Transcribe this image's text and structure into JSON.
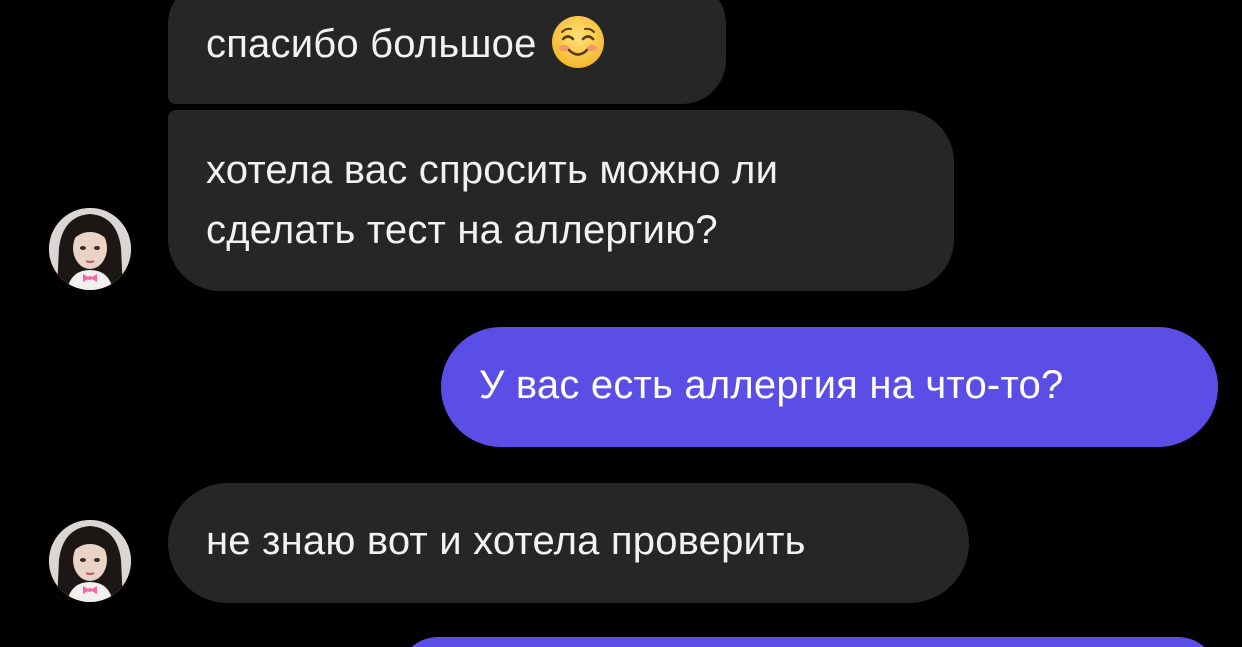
{
  "chat": {
    "messages": [
      {
        "sender": "contact",
        "text": "спасибо большое",
        "emoji": "smiling-face-emoji"
      },
      {
        "sender": "contact",
        "lines": [
          "хотела вас спросить можно ли",
          "сделать тест на аллергию?"
        ]
      },
      {
        "sender": "me",
        "text": "У вас есть аллергия на что-то?"
      },
      {
        "sender": "contact",
        "text": "не знаю вот и хотела проверить"
      },
      {
        "sender": "me",
        "text": ""
      }
    ]
  },
  "colors": {
    "background": "#000000",
    "incoming_bubble": "#262626",
    "outgoing_bubble": "#5b4ee6",
    "text": "#f2f2f2"
  }
}
